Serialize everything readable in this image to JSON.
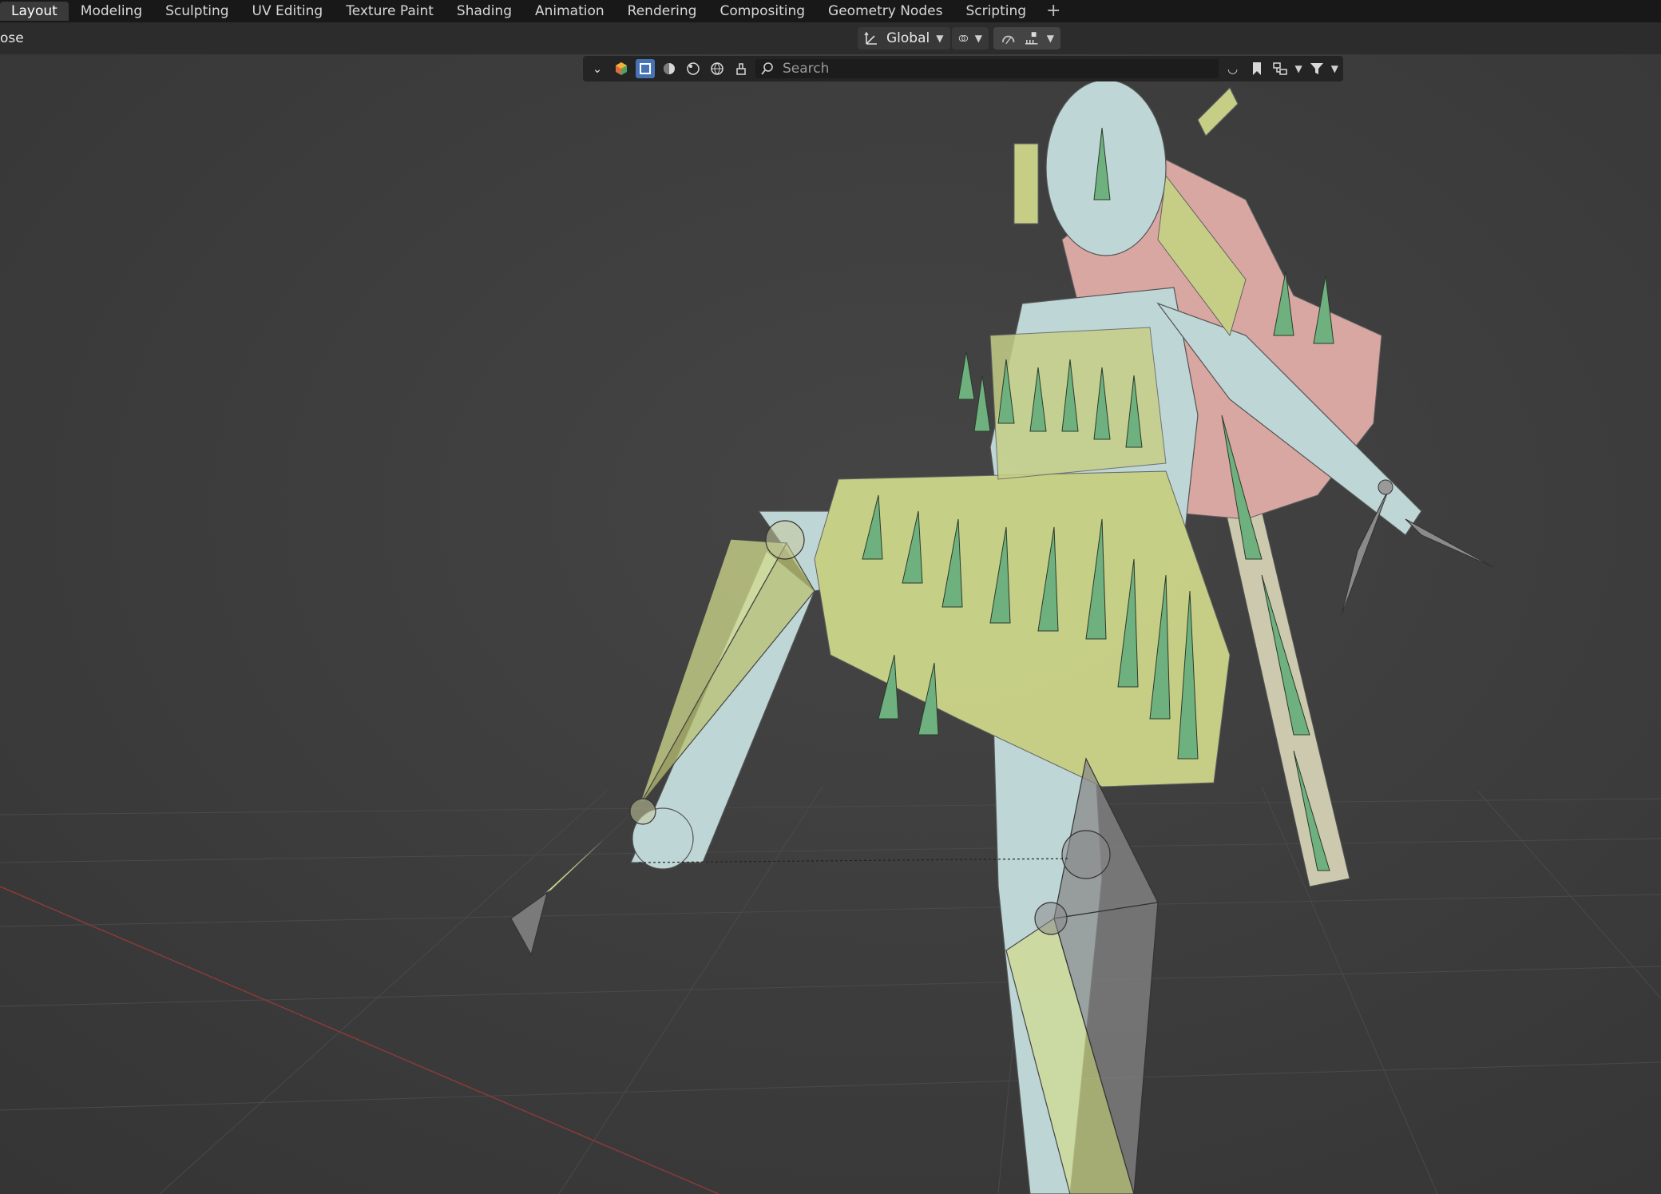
{
  "workspace_tabs": [
    {
      "label": "Layout",
      "active": true
    },
    {
      "label": "Modeling"
    },
    {
      "label": "Sculpting"
    },
    {
      "label": "UV Editing"
    },
    {
      "label": "Texture Paint"
    },
    {
      "label": "Shading"
    },
    {
      "label": "Animation"
    },
    {
      "label": "Rendering"
    },
    {
      "label": "Compositing"
    },
    {
      "label": "Geometry Nodes"
    },
    {
      "label": "Scripting"
    }
  ],
  "add_workspace": "+",
  "header": {
    "mode_label": "ose",
    "orientation": "Global"
  },
  "filterbar": {
    "search_placeholder": "Search"
  },
  "colors": {
    "body_mesh": "#c9e3e3",
    "bone_yellow": "#d2db8c",
    "bone_green": "#6fb07f",
    "bone_pink": "#e6b0ab",
    "accent_blue": "#4772b3"
  },
  "icons": [
    "transform-orientation-icon",
    "pivot-icon",
    "snap-icon",
    "proportional-icon",
    "object-type-icon",
    "select-mode-icon",
    "solid-shading-icon",
    "material-shading-icon",
    "render-shading-icon",
    "search-icon",
    "bookmark-icon",
    "filter-icon"
  ]
}
